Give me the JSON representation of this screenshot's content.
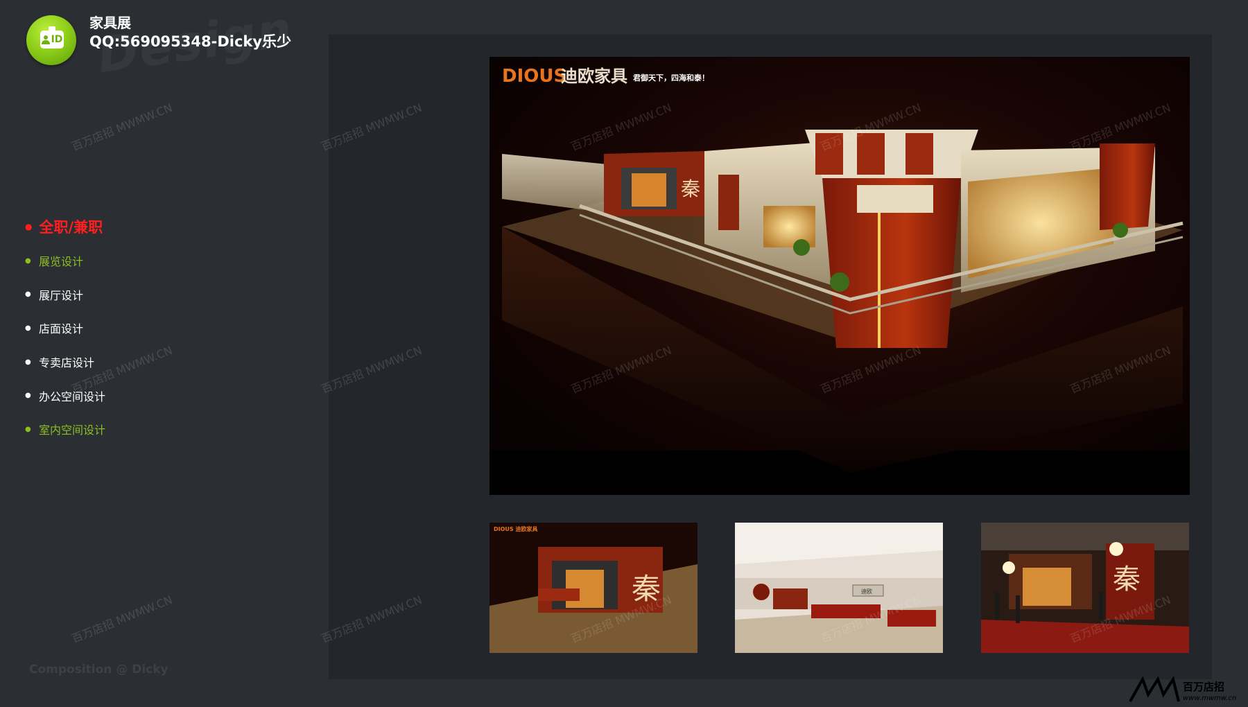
{
  "header": {
    "title": "家具展",
    "subtitle": "QQ:569095348-Dicky乐少",
    "avatar_badge": "ID",
    "avatar_icon": "id-card-icon"
  },
  "nav": {
    "heading": "全职/兼职",
    "items": [
      {
        "label": "展览设计",
        "color": "#8dbf22"
      },
      {
        "label": "展厅设计",
        "color": "#ffffff"
      },
      {
        "label": "店面设计",
        "color": "#ffffff"
      },
      {
        "label": "专卖店设计",
        "color": "#ffffff"
      },
      {
        "label": "办公空间设计",
        "color": "#ffffff"
      },
      {
        "label": "室内空间设计",
        "color": "#8dbf22"
      }
    ]
  },
  "credit": "Composition @ Dicky",
  "main_image": {
    "brand": "DIOUS",
    "brand_cn": "迪欧家具",
    "slogan": "君御天下，四海和泰！"
  },
  "thumbnails": [
    {
      "brand": "DIOUS 迪欧家具",
      "sign": "秦"
    },
    {
      "wall_sign": "迪欧"
    },
    {
      "sign": "秦"
    }
  ],
  "watermark": "百万店招 MWMW.CN",
  "corner_logo": {
    "text": "百万店招",
    "url_text": "www.mwmw.cn"
  },
  "colors": {
    "accent_green": "#8dbf22",
    "accent_red": "#ff1f1f",
    "background": "#2b2e33",
    "panel": "#23262a"
  }
}
